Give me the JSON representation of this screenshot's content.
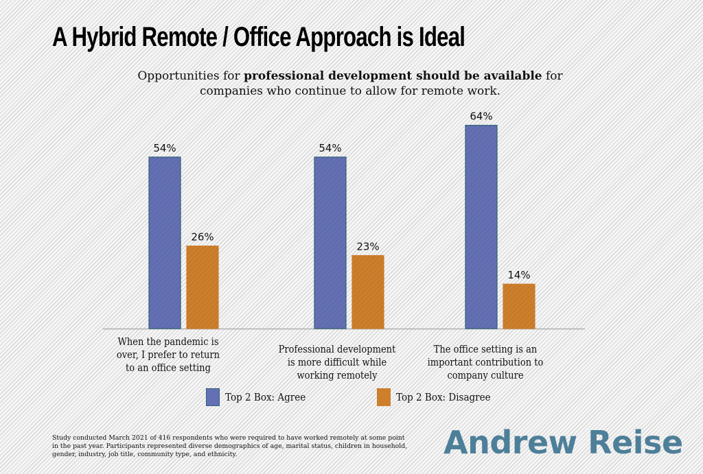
{
  "title": "A Hybrid Remote / Office Approach is Ideal",
  "subtitle": {
    "part1": "Opportunities for ",
    "bold": "professional development should be available",
    "part2": " for companies who continue to allow for remote work."
  },
  "colors": {
    "agree": "#6470b4",
    "disagree": "#cd7f2c",
    "bar_border_agree": "#2e5f7a",
    "axis": "#b0b0b0",
    "logo": "#4e7f99"
  },
  "chart_data": {
    "type": "bar",
    "title": "Opportunities for professional development should be available for companies who continue to allow for remote work.",
    "xlabel": "",
    "ylabel": "",
    "ylim": [
      0,
      64
    ],
    "grid": false,
    "legend_position": "bottom",
    "categories": [
      "When the pandemic is over, I prefer to return to an office setting",
      "Professional development is more difficult while working remotely",
      "The office setting is an important contribution to company culture"
    ],
    "category_lines": [
      [
        "When the pandemic is",
        "over, I prefer to return",
        "to an office setting"
      ],
      [
        "Professional development",
        "is more difficult while",
        "working remotely"
      ],
      [
        "The office setting is an",
        "important contribution to",
        "company culture"
      ]
    ],
    "series": [
      {
        "name": "Top 2 Box: Agree",
        "values": [
          54,
          54,
          64
        ],
        "labels": [
          "54%",
          "54%",
          "64%"
        ]
      },
      {
        "name": "Top 2 Box: Disagree",
        "values": [
          26,
          23,
          14
        ],
        "labels": [
          "26%",
          "23%",
          "14%"
        ]
      }
    ]
  },
  "footnote": "Study conducted March 2021 of 416 respondents who were required to have worked remotely at some point in the past year. Participants represented diverse demographics of age, marital status, children in household, gender, industry, job title, community type, and ethnicity.",
  "logo": "Andrew Reise"
}
